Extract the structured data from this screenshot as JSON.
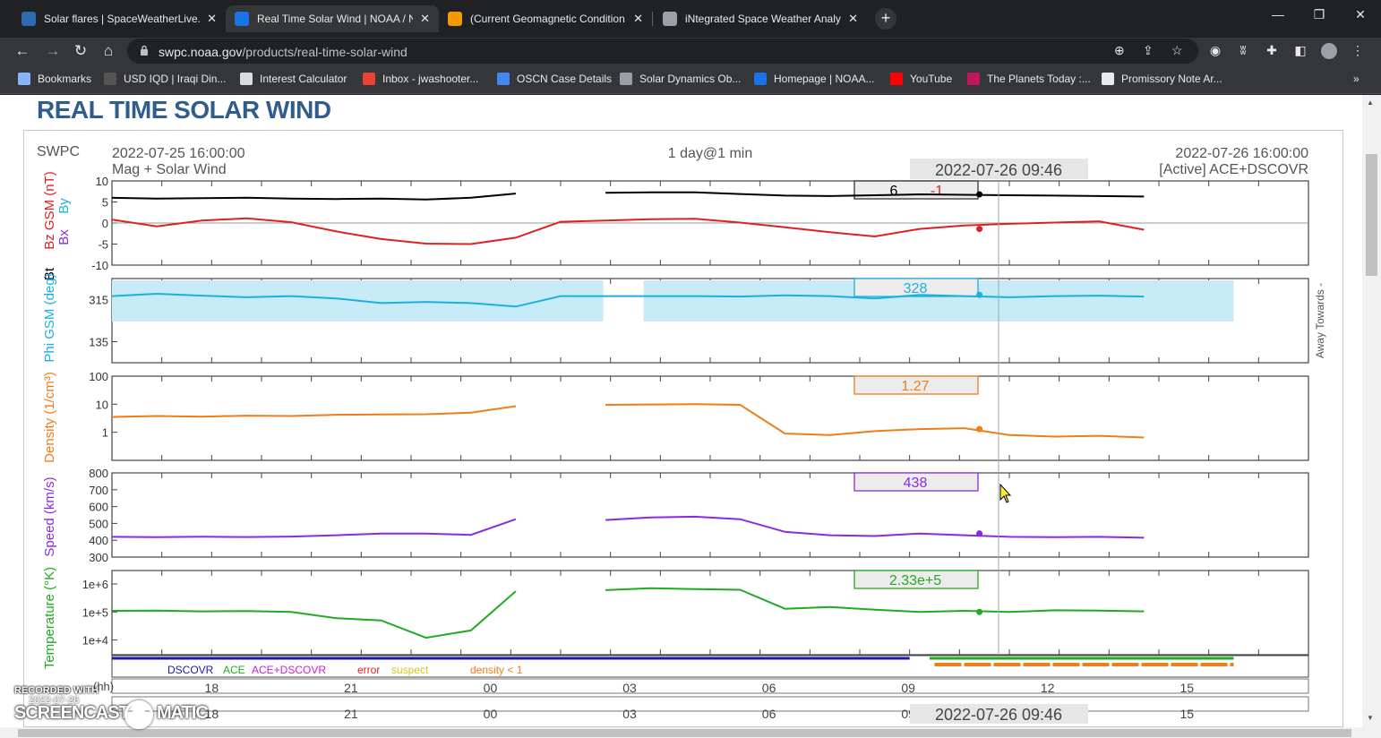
{
  "browser": {
    "tabs": [
      {
        "title": "Solar flares | SpaceWeatherLive.c",
        "favicon_color": "#2b6cb0",
        "active": false
      },
      {
        "title": "Real Time Solar Wind | NOAA / N",
        "favicon_color": "#1a73e8",
        "active": true
      },
      {
        "title": "(Current Geomagnetic Condition",
        "favicon_color": "#f29900",
        "active": false
      },
      {
        "title": "iNtegrated Space Weather Analy",
        "favicon_color": "#9aa0a6",
        "active": false
      }
    ],
    "tab_close": "✕",
    "new_tab": "+",
    "window": {
      "minimize": "—",
      "maximize": "❐",
      "close": "✕"
    },
    "nav": {
      "back": "←",
      "forward": "→",
      "reload": "↻",
      "home": "⌂"
    },
    "url_host": "swpc.noaa.gov",
    "url_path": "/products/real-time-solar-wind",
    "bookmarks": [
      {
        "label": "Bookmarks",
        "icon_color": "#8ab4f8"
      },
      {
        "label": "USD IQD | Iraqi Din...",
        "icon_color": "#555555"
      },
      {
        "label": "Interest Calculator",
        "icon_color": "#dadce0"
      },
      {
        "label": "Inbox - jwashooter...",
        "icon_color": "#ea4335"
      },
      {
        "label": "OSCN Case Details",
        "icon_color": "#4285f4"
      },
      {
        "label": "Solar Dynamics Ob...",
        "icon_color": "#9aa0a6"
      },
      {
        "label": "Homepage | NOAA...",
        "icon_color": "#1a73e8"
      },
      {
        "label": "YouTube",
        "icon_color": "#ff0000"
      },
      {
        "label": "The Planets Today :...",
        "icon_color": "#c2185b"
      },
      {
        "label": "Promissory Note Ar...",
        "icon_color": "#e8eaed"
      }
    ],
    "bookmarks_more": "»"
  },
  "page": {
    "heading": "REAL TIME SOLAR WIND"
  },
  "chart_data": {
    "type": "line",
    "header": {
      "source": "SWPC",
      "start": "2022-07-25 16:00:00",
      "subtitle": "Mag + Solar Wind",
      "span": "1 day@1 min",
      "end": "2022-07-26 16:00:00",
      "active": "[Active] ACE+DSCOVR",
      "cursor_time": "2022-07-26 09:46"
    },
    "x_ticks": [
      "18",
      "21",
      "00",
      "03",
      "06",
      "09",
      "12",
      "15"
    ],
    "x_unit": "(hh)",
    "colors": {
      "bt": "#000000",
      "bz": "#e02020",
      "bx": "#8a2be2",
      "by": "#1ab0e0",
      "phi": "#1ab0e0",
      "density": "#f07d1a",
      "speed": "#8a2be2",
      "temperature": "#22aa22"
    },
    "panels": [
      {
        "id": "mag",
        "ylabel_parts": [
          "Bt",
          "Bz GSM (nT)",
          "Bx",
          "By"
        ],
        "y_ticks": [
          "10",
          "5",
          "0",
          "-5",
          "-10"
        ],
        "ylim": [
          -10,
          10
        ],
        "cursor_values": [
          "6",
          "-1"
        ],
        "series": [
          {
            "name": "Bt",
            "x_hours": [
              0,
              1,
              2,
              3,
              4,
              5,
              6,
              7,
              8,
              9,
              10,
              11,
              12,
              13,
              14,
              15,
              16,
              17,
              18,
              19,
              20,
              21,
              22,
              23,
              24
            ],
            "values": [
              6,
              5.8,
              5.9,
              6,
              5.8,
              5.7,
              5.8,
              5.6,
              6,
              7,
              null,
              7.2,
              7.3,
              7.3,
              6.9,
              6.5,
              6.4,
              6.6,
              6.8,
              6.7,
              6.6,
              6.5,
              6.4,
              6.3,
              null
            ]
          },
          {
            "name": "Bz",
            "x_hours": [
              0,
              1,
              2,
              3,
              4,
              5,
              6,
              7,
              8,
              9,
              10,
              11,
              12,
              13,
              14,
              15,
              16,
              17,
              18,
              19,
              20,
              21,
              22,
              23,
              24
            ],
            "values": [
              0.8,
              -0.8,
              0.6,
              1.1,
              0.2,
              -2,
              -3.8,
              -4.9,
              -5,
              -3.5,
              0.3,
              0.6,
              0.9,
              1.0,
              0.1,
              -1,
              -2.2,
              -3.2,
              -1.4,
              -0.6,
              -0.2,
              0.1,
              0.4,
              -1.6,
              null
            ]
          }
        ]
      },
      {
        "id": "phi",
        "ylabel_parts": [
          "Phi GSM (deg)"
        ],
        "y_ticks": [
          "315",
          "135"
        ],
        "ylim": [
          45,
          405
        ],
        "right_label": "Away Towards -",
        "cursor_values": [
          "328"
        ],
        "series": [
          {
            "name": "Phi",
            "x_hours": [
              0,
              1,
              2,
              3,
              4,
              5,
              6,
              7,
              8,
              9,
              10,
              11,
              12,
              13,
              14,
              15,
              16,
              17,
              18,
              19,
              20,
              21,
              22,
              23,
              24
            ],
            "values": [
              330,
              340,
              332,
              325,
              330,
              320,
              300,
              305,
              300,
              285,
              330,
              330,
              330,
              330,
              328,
              333,
              330,
              320,
              335,
              330,
              325,
              330,
              332,
              328,
              null
            ]
          }
        ]
      },
      {
        "id": "density",
        "ylabel_parts": [
          "Density (1/cm³)"
        ],
        "y_ticks": [
          "100",
          "10",
          "1"
        ],
        "y_scale": "log",
        "ylim": [
          0.1,
          100
        ],
        "cursor_values": [
          "1.27"
        ],
        "series": [
          {
            "name": "Density",
            "x_hours": [
              0,
              1,
              2,
              3,
              4,
              5,
              6,
              7,
              8,
              9,
              10,
              11,
              12,
              13,
              14,
              15,
              16,
              17,
              18,
              19,
              20,
              21,
              22,
              23,
              24
            ],
            "values": [
              3.5,
              3.8,
              3.6,
              3.9,
              3.8,
              4.2,
              4.3,
              4.4,
              5,
              8.5,
              null,
              9.5,
              9.8,
              10,
              9.5,
              0.9,
              0.8,
              1.1,
              1.3,
              1.4,
              0.8,
              0.7,
              0.75,
              0.65,
              null
            ]
          }
        ]
      },
      {
        "id": "speed",
        "ylabel_parts": [
          "Speed (km/s)"
        ],
        "y_ticks": [
          "800",
          "700",
          "600",
          "500",
          "400",
          "300"
        ],
        "ylim": [
          300,
          800
        ],
        "cursor_values": [
          "438"
        ],
        "series": [
          {
            "name": "Speed",
            "x_hours": [
              0,
              1,
              2,
              3,
              4,
              5,
              6,
              7,
              8,
              9,
              10,
              11,
              12,
              13,
              14,
              15,
              16,
              17,
              18,
              19,
              20,
              21,
              22,
              23,
              24
            ],
            "values": [
              420,
              418,
              421,
              419,
              422,
              430,
              440,
              440,
              432,
              525,
              null,
              520,
              535,
              540,
              525,
              450,
              430,
              425,
              440,
              430,
              420,
              418,
              420,
              415,
              null
            ]
          }
        ]
      },
      {
        "id": "temperature",
        "ylabel_parts": [
          "Temperature (°K)"
        ],
        "y_ticks": [
          "1e+6",
          "1e+5",
          "1e+4"
        ],
        "y_scale": "log",
        "ylim": [
          3000,
          3000000
        ],
        "cursor_values": [
          "2.33e+5"
        ],
        "series": [
          {
            "name": "Temperature",
            "x_hours": [
              0,
              1,
              2,
              3,
              4,
              5,
              6,
              7,
              8,
              9,
              10,
              11,
              12,
              13,
              14,
              15,
              16,
              17,
              18,
              19,
              20,
              21,
              22,
              23,
              24
            ],
            "values": [
              110000,
              112000,
              105000,
              108000,
              100000,
              60000,
              50000,
              12000,
              22000,
              550000,
              null,
              600000,
              700000,
              650000,
              620000,
              130000,
              150000,
              120000,
              100000,
              110000,
              100000,
              115000,
              112000,
              105000,
              null
            ]
          }
        ]
      }
    ],
    "source_legend": [
      {
        "label": "DSCOVR",
        "color": "#1a1aa6"
      },
      {
        "label": "ACE",
        "color": "#22aa22"
      },
      {
        "label": "ACE+DSCOVR",
        "color": "#cc22cc"
      },
      {
        "label": "error",
        "color": "#e02020"
      },
      {
        "label": "suspect",
        "color": "#d6c81a"
      },
      {
        "label": "density < 1",
        "color": "#f07d1a"
      }
    ]
  },
  "watermark": {
    "top": "RECORDED WITH",
    "date": "2022-07-26",
    "brand_left": "SCREENCAST",
    "brand_right": "MATIC"
  }
}
